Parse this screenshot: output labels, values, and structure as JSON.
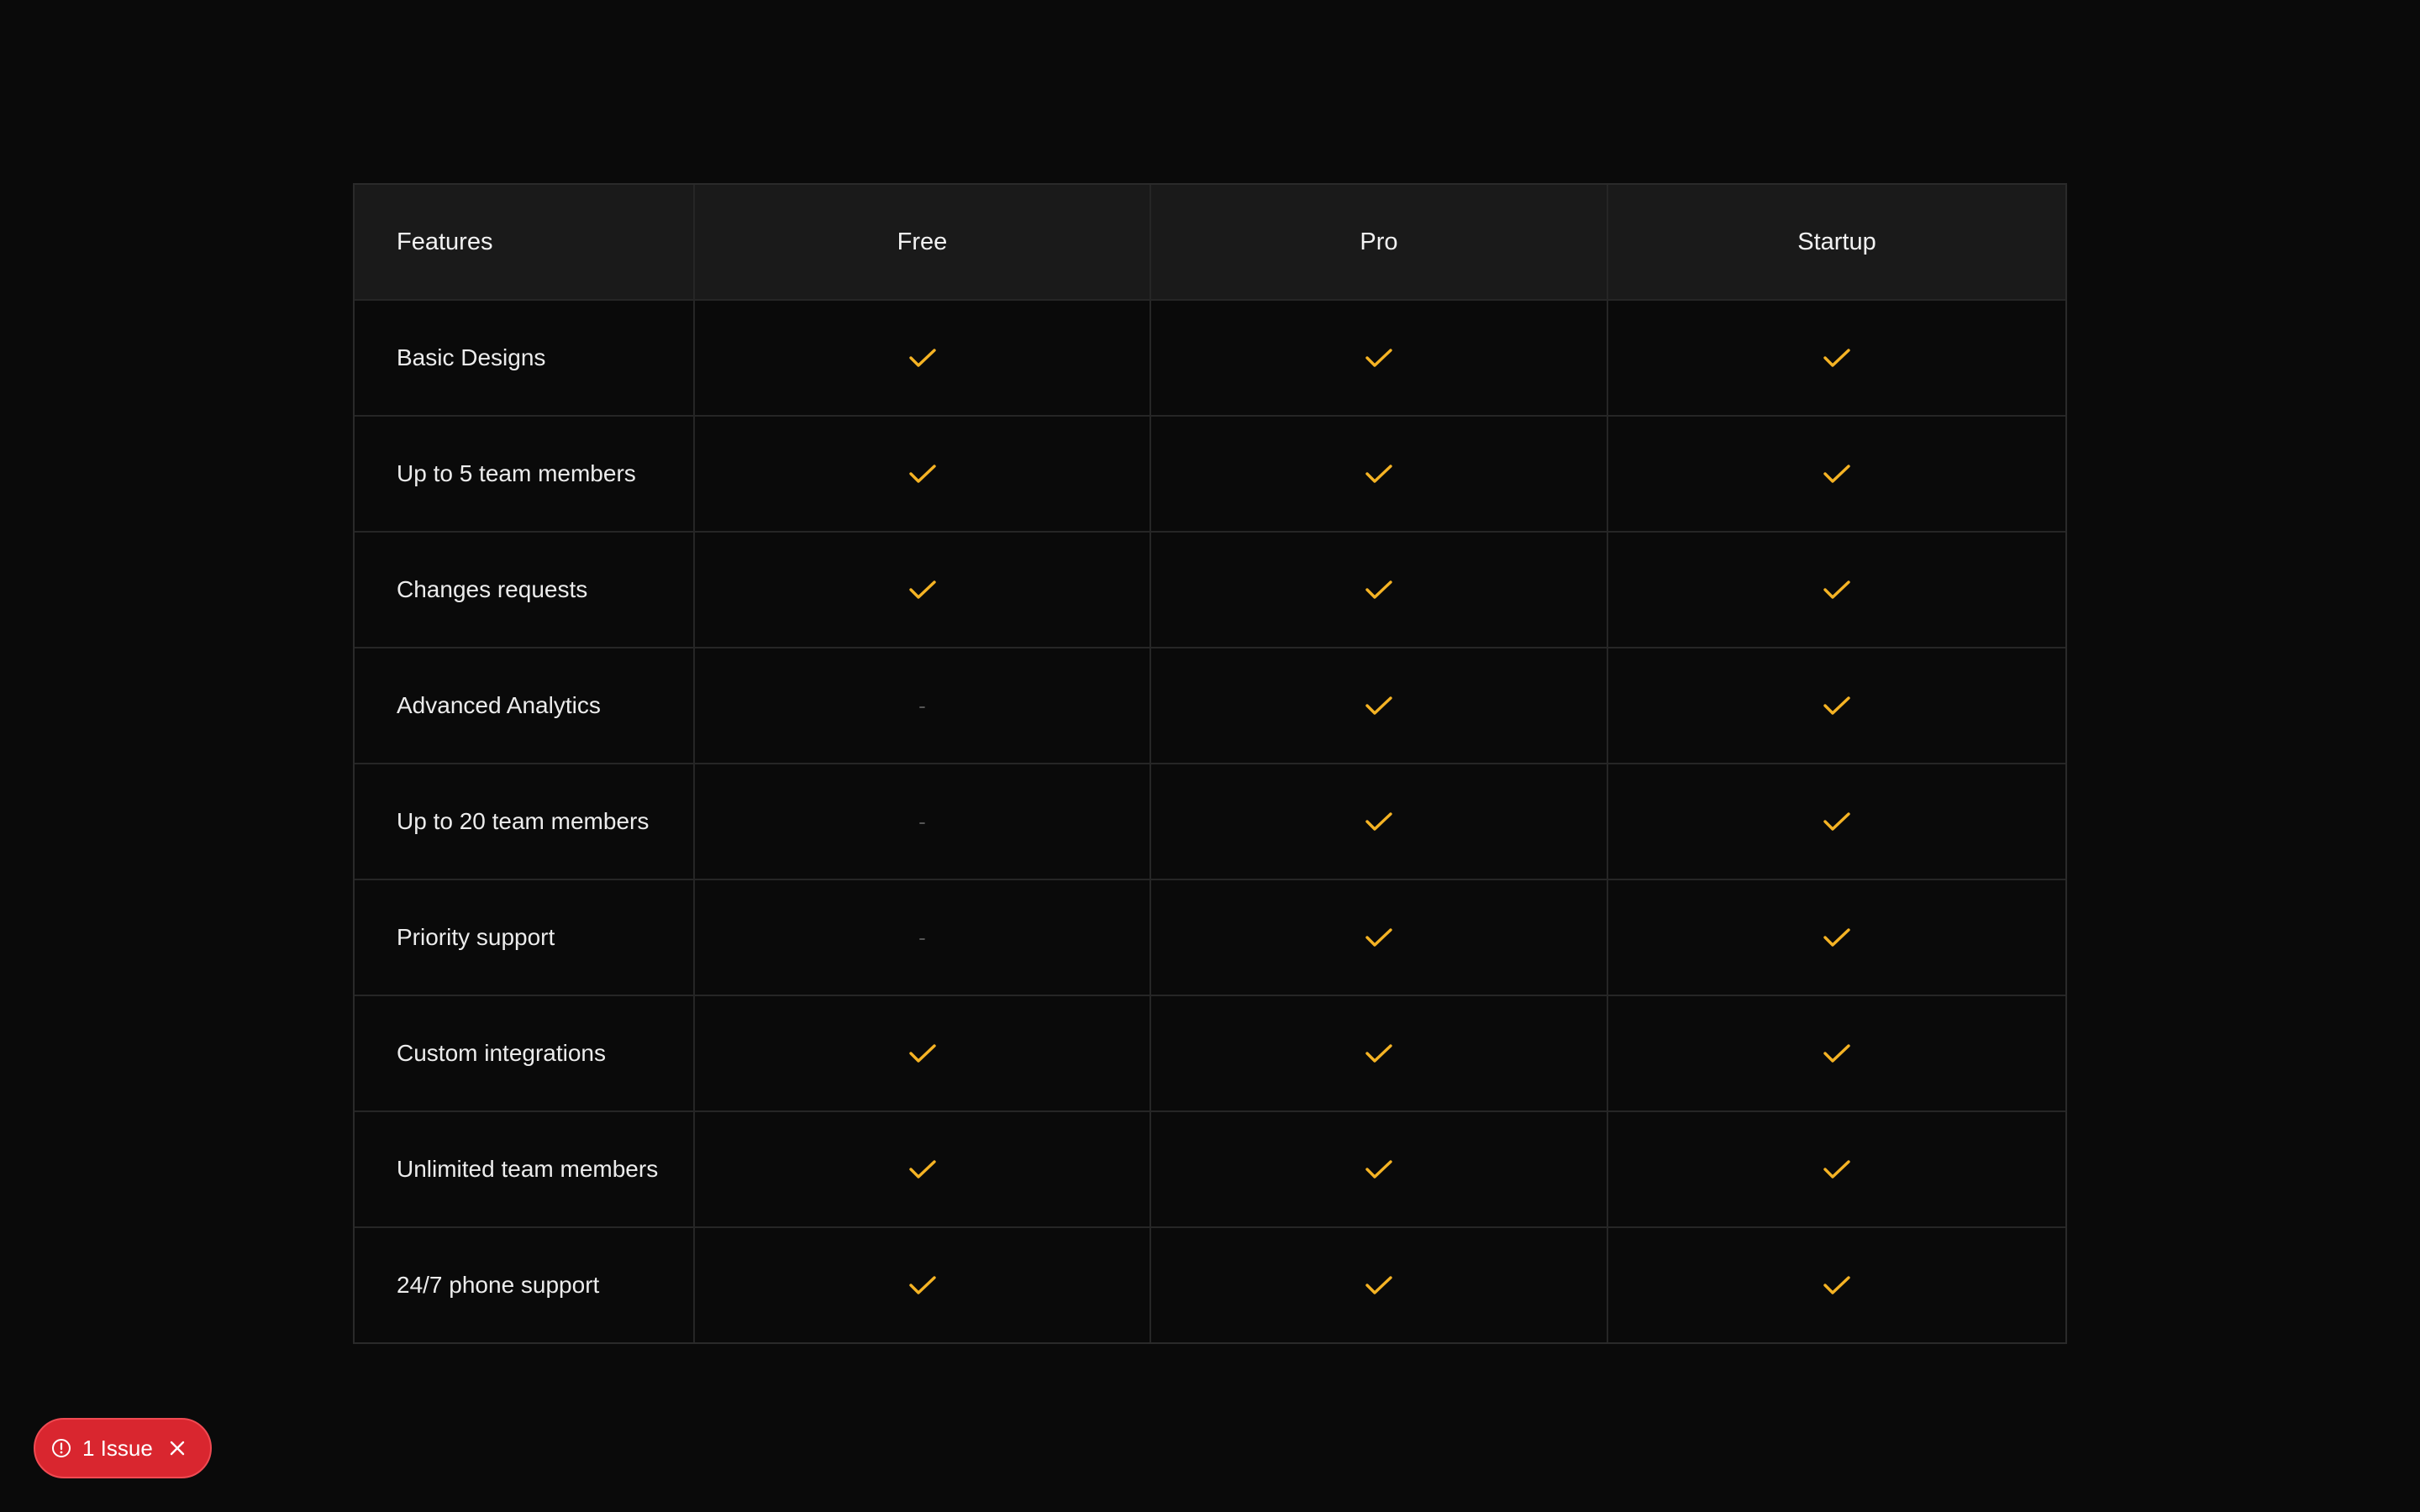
{
  "table": {
    "columns": [
      "Features",
      "Free",
      "Pro",
      "Startup"
    ],
    "rows": [
      {
        "feature": "Basic Designs",
        "values": [
          "check",
          "check",
          "check"
        ]
      },
      {
        "feature": "Up to 5 team members",
        "values": [
          "check",
          "check",
          "check"
        ]
      },
      {
        "feature": "Changes requests",
        "values": [
          "check",
          "check",
          "check"
        ]
      },
      {
        "feature": "Advanced Analytics",
        "values": [
          "-",
          "check",
          "check"
        ]
      },
      {
        "feature": "Up to 20 team members",
        "values": [
          "-",
          "check",
          "check"
        ]
      },
      {
        "feature": "Priority support",
        "values": [
          "-",
          "check",
          "check"
        ]
      },
      {
        "feature": "Custom integrations",
        "values": [
          "check",
          "check",
          "check"
        ]
      },
      {
        "feature": "Unlimited team members",
        "values": [
          "check",
          "check",
          "check"
        ]
      },
      {
        "feature": "24/7 phone support",
        "values": [
          "check",
          "check",
          "check"
        ]
      }
    ]
  },
  "colors": {
    "check": "#f5b324",
    "badge": "#d9262f"
  },
  "issue_badge": {
    "label": "1 Issue",
    "icon": "alert-circle-icon",
    "close_icon": "close-icon"
  }
}
